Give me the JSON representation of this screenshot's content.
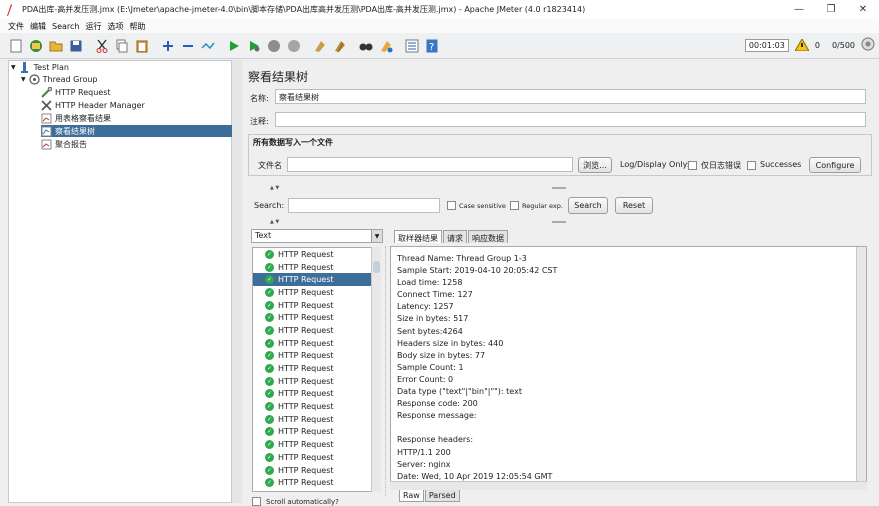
{
  "window": {
    "title": "PDA出库-高并发压测.jmx (E:\\Jmeter\\apache-jmeter-4.0\\bin\\脚本存储\\PDA出库高并发压测\\PDA出库-高并发压测.jmx) - Apache JMeter (4.0 r1823414)",
    "minimize": "—",
    "restore": "❐",
    "close": "✕"
  },
  "menu": [
    "文件",
    "编辑",
    "Search",
    "运行",
    "选项",
    "帮助"
  ],
  "toolbar": {
    "timer": "00:01:03",
    "warning_count": "0",
    "threads": "0/500"
  },
  "tree": {
    "nodes": [
      {
        "label": "Test Plan",
        "icon": "test-plan-icon"
      },
      {
        "label": "Thread Group",
        "icon": "thread-group-icon"
      },
      {
        "label": "HTTP Request",
        "icon": "http-request-icon"
      },
      {
        "label": "HTTP Header Manager",
        "icon": "header-manager-icon"
      },
      {
        "label": "用表格察看结果",
        "icon": "table-results-icon"
      },
      {
        "label": "察看结果树",
        "icon": "results-tree-icon"
      },
      {
        "label": "聚合报告",
        "icon": "aggregate-report-icon"
      }
    ]
  },
  "panel": {
    "title": "察看结果树",
    "name_label": "名称:",
    "name_value": "察看结果树",
    "comment_label": "注释:",
    "comment_value": "",
    "file_group_title": "所有数据写入一个文件",
    "filename_label": "文件名",
    "filename_value": "",
    "browse_button": "浏览...",
    "log_display_label": "Log/Display Only:",
    "errors_only_label": "仅日志错误",
    "successes_label": "Successes",
    "configure_button": "Configure",
    "search_label": "Search:",
    "search_value": "",
    "case_sensitive_label": "Case sensitive",
    "regex_label": "Regular exp.",
    "search_button": "Search",
    "reset_button": "Reset",
    "renderer": "Text",
    "scroll_auto_label": "Scroll automatically?"
  },
  "results": {
    "items": [
      "HTTP Request",
      "HTTP Request",
      "HTTP Request",
      "HTTP Request",
      "HTTP Request",
      "HTTP Request",
      "HTTP Request",
      "HTTP Request",
      "HTTP Request",
      "HTTP Request",
      "HTTP Request",
      "HTTP Request",
      "HTTP Request",
      "HTTP Request",
      "HTTP Request",
      "HTTP Request",
      "HTTP Request",
      "HTTP Request",
      "HTTP Request"
    ],
    "selected_index": 2
  },
  "detail": {
    "tabs": [
      "取样器结果",
      "请求",
      "响应数据"
    ],
    "active_tab": 0,
    "bottom_tabs": [
      "Raw",
      "Parsed"
    ],
    "lines": [
      "Thread Name: Thread Group 1-3",
      "Sample Start: 2019-04-10 20:05:42 CST",
      "Load time: 1258",
      "Connect Time: 127",
      "Latency: 1257",
      "Size in bytes: 517",
      "Sent bytes:4264",
      "Headers size in bytes: 440",
      "Body size in bytes: 77",
      "Sample Count: 1",
      "Error Count: 0",
      "Data type (\"text\"|\"bin\"|\"\"): text",
      "Response code: 200",
      "Response message:",
      "",
      "Response headers:",
      "HTTP/1.1 200",
      "Server: nginx",
      "Date: Wed, 10 Apr 2019 12:05:54 GMT"
    ]
  }
}
